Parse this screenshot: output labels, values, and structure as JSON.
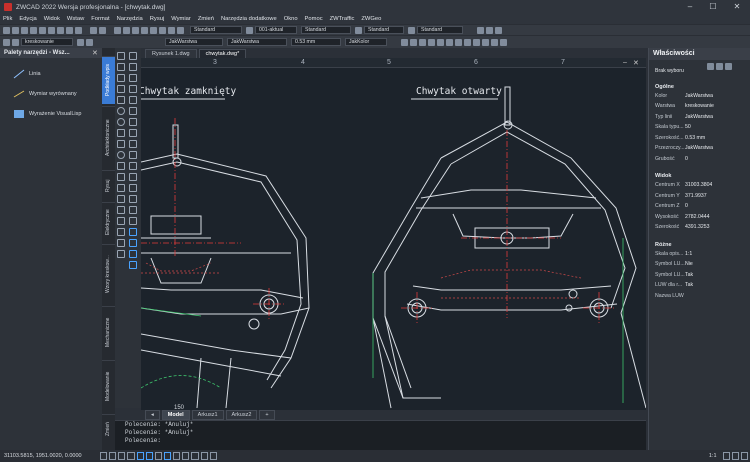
{
  "app": {
    "title": "ZWCAD 2022 Wersja profesjonalna - [chwytak.dwg]"
  },
  "menu": [
    "Plik",
    "Edycja",
    "Widok",
    "Wstaw",
    "Format",
    "Narzędzia",
    "Rysuj",
    "Wymiar",
    "Zmień",
    "Narzędzia dodatkowe",
    "Okno",
    "Pomoc",
    "ZWTraffic",
    "ZWGeo"
  ],
  "toolbar": {
    "style1": "Standard",
    "layer_combo": "JakWarstwa",
    "layer_combo2": "JakWarstwa",
    "layer_name": "001-aktual",
    "lineweight": "0.53 mm",
    "color": "JakKolor",
    "dim_style": "Standard",
    "table_style": "Standard",
    "text_style": "Standard",
    "linetype_combo": "kreskowanie"
  },
  "palette": {
    "title": "Palety narzędzi - Wsz...",
    "items": [
      "Linia",
      "Wymiar wyrównany",
      "Wyrażenie VisualLisp"
    ],
    "tabs": [
      "Podkłady wpis",
      "Architektoniczne",
      "Rysuj",
      "Elektryczne",
      "Wzory kreskow...",
      "Mechaniczne",
      "Modelowanie",
      "Zmień"
    ]
  },
  "doc_tabs": [
    "Rysunek 1.dwg",
    "chwytak.dwg*"
  ],
  "ruler_numbers": [
    "3",
    "4",
    "5",
    "6",
    "7"
  ],
  "canvas": {
    "title_left": "Chwytak zamknięty",
    "title_right": "Chwytak otwarty",
    "tick_150": "150"
  },
  "layout_tabs": [
    "Model",
    "Arkusz1",
    "Arkusz2",
    "+"
  ],
  "commands": [
    "Polecenie: *Anuluj*",
    "Polecenie: *Anuluj*",
    "Polecenie:"
  ],
  "status": {
    "coords": "31103.5815, 1951.0020, 0.0000",
    "scale": "1:1"
  },
  "props": {
    "title": "Właściwości",
    "selection": "Brak wyboru",
    "general_label": "Ogólne",
    "general": [
      {
        "k": "Kolor",
        "v": "JakWarstwa"
      },
      {
        "k": "Warstwa",
        "v": "kreskowanie"
      },
      {
        "k": "Typ linii",
        "v": "JakWarstwa"
      },
      {
        "k": "Skala typu...",
        "v": "50"
      },
      {
        "k": "Szerokość...",
        "v": "0.53 mm"
      },
      {
        "k": "Przezroczy...",
        "v": "JakWarstwa"
      },
      {
        "k": "Grubość",
        "v": "0"
      }
    ],
    "view_label": "Widok",
    "view": [
      {
        "k": "Centrum X",
        "v": "31003.3804"
      },
      {
        "k": "Centrum Y",
        "v": "371.9937"
      },
      {
        "k": "Centrum Z",
        "v": "0"
      },
      {
        "k": "Wysokość",
        "v": "2782.0444"
      },
      {
        "k": "Szerokość",
        "v": "4391.3253"
      }
    ],
    "misc_label": "Różne",
    "misc": [
      {
        "k": "Skala opis...",
        "v": "1:1"
      },
      {
        "k": "Symbol LU...",
        "v": "Nie"
      },
      {
        "k": "Symbol LU...",
        "v": "Tak"
      },
      {
        "k": "LUW dla r...",
        "v": "Tak"
      },
      {
        "k": "Nazwa LUW",
        "v": ""
      }
    ]
  }
}
